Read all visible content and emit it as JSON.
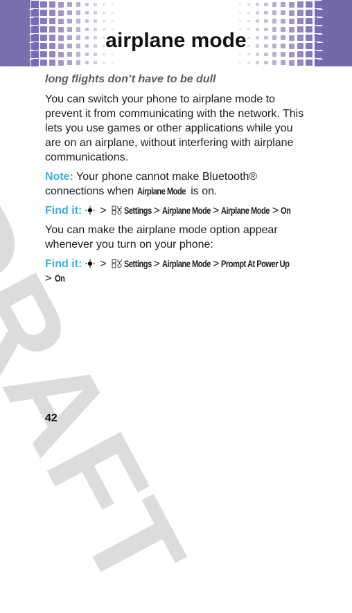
{
  "header": {
    "title": "airplane mode",
    "band_color": "#7a6fae"
  },
  "section": {
    "subtitle": "long flights don’t have to be dull",
    "intro": "You can switch your phone to airplane mode to prevent it from communicating with the network. This lets you use games or other applications while you are on an airplane, without interfering with airplane communications.",
    "note": {
      "label": "Note:",
      "text_before": " Your phone cannot make Bluetooth® connections when ",
      "ui_term": "Airplane Mode",
      "text_after": " is on."
    },
    "find_it_1": {
      "label": "Find it:",
      "nav_icon": "navigation-key-icon",
      "settings_icon": "settings-icon",
      "steps": [
        "Settings",
        "Airplane Mode",
        "Airplane Mode",
        "On"
      ]
    },
    "paragraph_2": "You can make the airplane mode option appear whenever you turn on your phone:",
    "find_it_2": {
      "label": "Find it:",
      "nav_icon": "navigation-key-icon",
      "settings_icon": "settings-icon",
      "steps": [
        "Settings",
        "Airplane Mode",
        "Prompt At Power Up",
        "On"
      ]
    },
    "separator": ">"
  },
  "watermark": "DRAFT",
  "page_number": "42",
  "colors": {
    "accent": "#3aaee0",
    "purple": "#7a6fae",
    "watermark": "#dcdcdc"
  }
}
